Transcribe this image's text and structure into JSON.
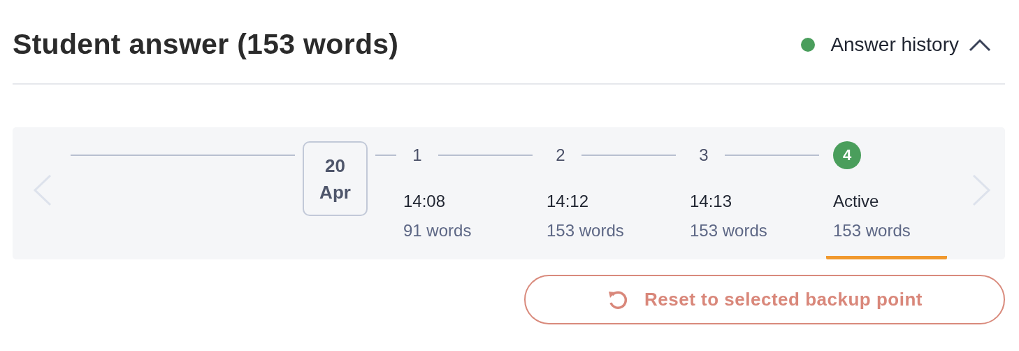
{
  "title": "Student answer (153 words)",
  "history": {
    "label": "Answer history",
    "color": "#4a9e5c",
    "expanded": true
  },
  "timeline": {
    "date": {
      "day": "20",
      "month": "Apr"
    },
    "backups": [
      {
        "number": "1",
        "time": "14:08",
        "words": "91 words",
        "selected": false
      },
      {
        "number": "2",
        "time": "14:12",
        "words": "153 words",
        "selected": false
      },
      {
        "number": "3",
        "time": "14:13",
        "words": "153 words",
        "selected": false
      },
      {
        "number": "4",
        "time": "Active",
        "words": "153 words",
        "selected": true
      }
    ]
  },
  "reset_button": "Reset to selected backup point"
}
